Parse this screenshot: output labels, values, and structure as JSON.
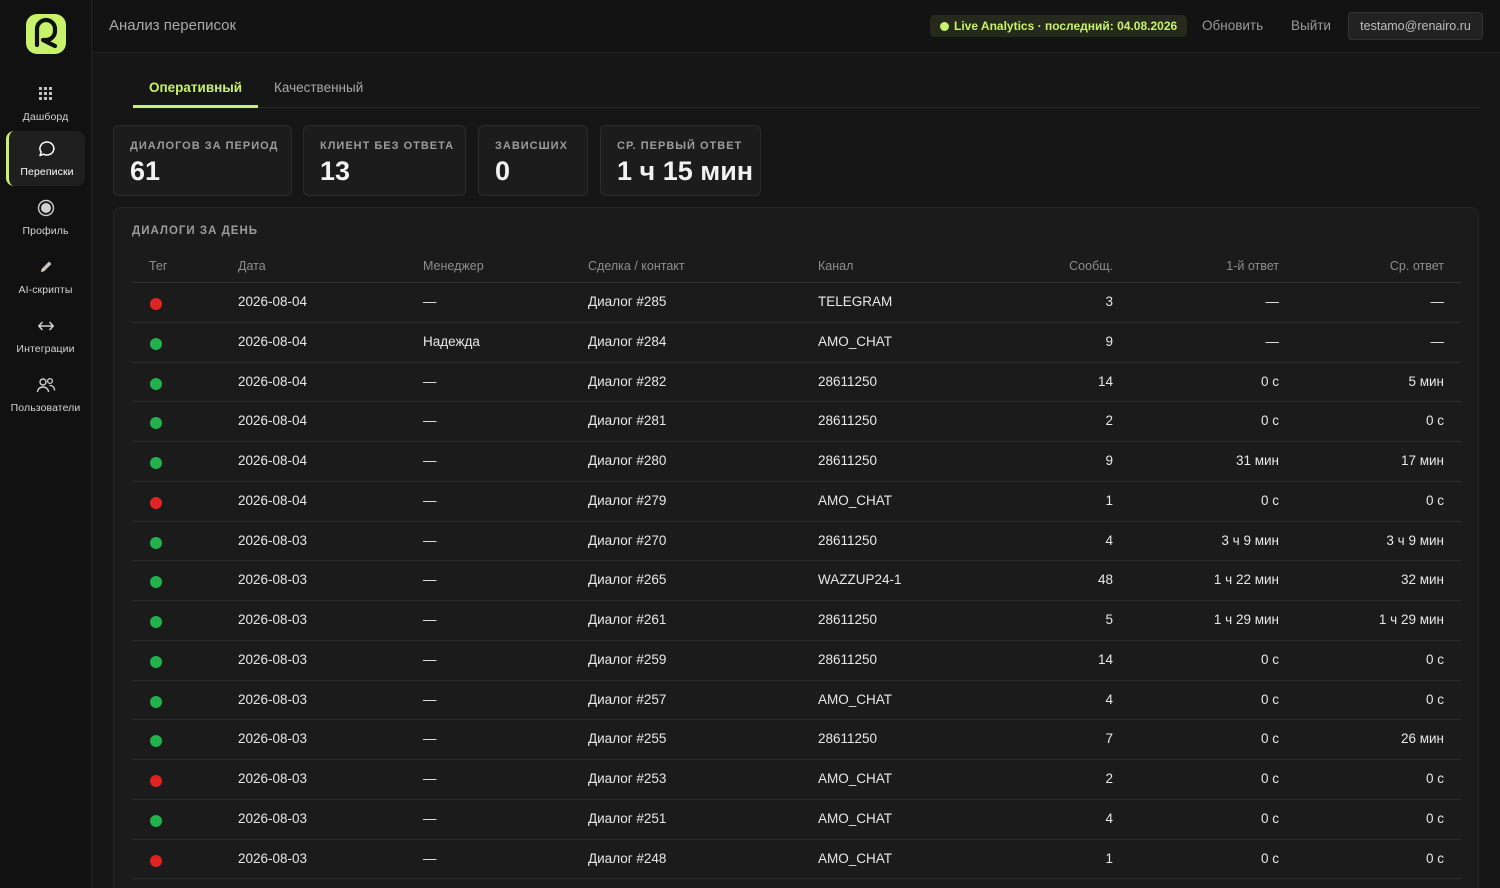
{
  "colors": {
    "accent": "#c8f26b",
    "ok": "#22b14c",
    "bad": "#e02424"
  },
  "sidebar": {
    "items": [
      {
        "label": "Дашборд",
        "icon": "dashboard-icon",
        "active": false
      },
      {
        "label": "Переписки",
        "icon": "chat-bubble-icon",
        "active": true
      },
      {
        "label": "Профиль",
        "icon": "profile-icon",
        "active": false
      },
      {
        "label": "AI-скрипты",
        "icon": "pencil-icon",
        "active": false
      },
      {
        "label": "Интеграции",
        "icon": "arrows-icon",
        "active": false
      },
      {
        "label": "Пользователи",
        "icon": "users-icon",
        "active": false
      }
    ]
  },
  "header": {
    "title": "Анализ переписок",
    "live_label": "Live Analytics",
    "last_text": "· последний: 04.08.2026",
    "refresh": "Обновить",
    "logout": "Выйти",
    "user": "testamo@renairo.ru"
  },
  "tabs": [
    {
      "label": "Оперативный",
      "active": true
    },
    {
      "label": "Качественный",
      "active": false
    }
  ],
  "stats": [
    {
      "label": "ДИАЛОГОВ ЗА ПЕРИОД",
      "value": "61"
    },
    {
      "label": "КЛИЕНТ БЕЗ ОТВЕТА",
      "value": "13"
    },
    {
      "label": "ЗАВИСШИХ",
      "value": "0"
    },
    {
      "label": "СР. ПЕРВЫЙ ОТВЕТ",
      "value": "1 ч 15 мин"
    }
  ],
  "table": {
    "title": "ДИАЛОГИ ЗА ДЕНЬ",
    "columns": [
      "Тег",
      "Дата",
      "Менеджер",
      "Сделка / контакт",
      "Канал",
      "Сообщ.",
      "1-й ответ",
      "Ср. ответ"
    ],
    "rows": [
      {
        "tag": "red",
        "date": "2026-08-04",
        "manager": "—",
        "deal": "Диалог #285",
        "channel": "TELEGRAM",
        "msgs": "3",
        "first": "—",
        "avg": "—"
      },
      {
        "tag": "green",
        "date": "2026-08-04",
        "manager": "Надежда",
        "deal": "Диалог #284",
        "channel": "AMO_CHAT",
        "msgs": "9",
        "first": "—",
        "avg": "—"
      },
      {
        "tag": "green",
        "date": "2026-08-04",
        "manager": "—",
        "deal": "Диалог #282",
        "channel": "28611250",
        "msgs": "14",
        "first": "0 с",
        "avg": "5 мин"
      },
      {
        "tag": "green",
        "date": "2026-08-04",
        "manager": "—",
        "deal": "Диалог #281",
        "channel": "28611250",
        "msgs": "2",
        "first": "0 с",
        "avg": "0 с"
      },
      {
        "tag": "green",
        "date": "2026-08-04",
        "manager": "—",
        "deal": "Диалог #280",
        "channel": "28611250",
        "msgs": "9",
        "first": "31 мин",
        "avg": "17 мин"
      },
      {
        "tag": "red",
        "date": "2026-08-04",
        "manager": "—",
        "deal": "Диалог #279",
        "channel": "AMO_CHAT",
        "msgs": "1",
        "first": "0 с",
        "avg": "0 с"
      },
      {
        "tag": "green",
        "date": "2026-08-03",
        "manager": "—",
        "deal": "Диалог #270",
        "channel": "28611250",
        "msgs": "4",
        "first": "3 ч 9 мин",
        "avg": "3 ч 9 мин"
      },
      {
        "tag": "green",
        "date": "2026-08-03",
        "manager": "—",
        "deal": "Диалог #265",
        "channel": "WAZZUP24-1",
        "msgs": "48",
        "first": "1 ч 22 мин",
        "avg": "32 мин"
      },
      {
        "tag": "green",
        "date": "2026-08-03",
        "manager": "—",
        "deal": "Диалог #261",
        "channel": "28611250",
        "msgs": "5",
        "first": "1 ч 29 мин",
        "avg": "1 ч 29 мин"
      },
      {
        "tag": "green",
        "date": "2026-08-03",
        "manager": "—",
        "deal": "Диалог #259",
        "channel": "28611250",
        "msgs": "14",
        "first": "0 с",
        "avg": "0 с"
      },
      {
        "tag": "green",
        "date": "2026-08-03",
        "manager": "—",
        "deal": "Диалог #257",
        "channel": "AMO_CHAT",
        "msgs": "4",
        "first": "0 с",
        "avg": "0 с"
      },
      {
        "tag": "green",
        "date": "2026-08-03",
        "manager": "—",
        "deal": "Диалог #255",
        "channel": "28611250",
        "msgs": "7",
        "first": "0 с",
        "avg": "26 мин"
      },
      {
        "tag": "red",
        "date": "2026-08-03",
        "manager": "—",
        "deal": "Диалог #253",
        "channel": "AMO_CHAT",
        "msgs": "2",
        "first": "0 с",
        "avg": "0 с"
      },
      {
        "tag": "green",
        "date": "2026-08-03",
        "manager": "—",
        "deal": "Диалог #251",
        "channel": "AMO_CHAT",
        "msgs": "4",
        "first": "0 с",
        "avg": "0 с"
      },
      {
        "tag": "red",
        "date": "2026-08-03",
        "manager": "—",
        "deal": "Диалог #248",
        "channel": "AMO_CHAT",
        "msgs": "1",
        "first": "0 с",
        "avg": "0 с"
      }
    ]
  }
}
